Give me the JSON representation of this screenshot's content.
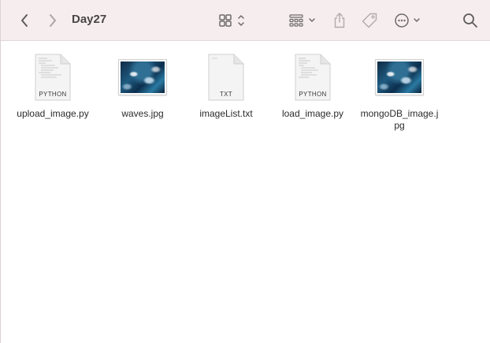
{
  "window": {
    "title": "Day27"
  },
  "toolbar": {
    "back_icon": "chevron-left-icon",
    "forward_icon": "chevron-right-icon",
    "view_icon": "grid-view-icon",
    "group_icon": "group-by-icon",
    "share_icon": "share-icon",
    "tag_icon": "tag-icon",
    "more_icon": "ellipsis-circle-icon",
    "search_icon": "search-icon"
  },
  "files": [
    {
      "name": "upload_image.py",
      "kind": "document",
      "badge": "PYTHON"
    },
    {
      "name": "waves.jpg",
      "kind": "image"
    },
    {
      "name": "imageList.txt",
      "kind": "document",
      "badge": "TXT"
    },
    {
      "name": "load_image.py",
      "kind": "document",
      "badge": "PYTHON"
    },
    {
      "name": "mongoDB_image.jpg",
      "kind": "image"
    }
  ],
  "colors": {
    "toolbar_bg": "#f6eeee",
    "icon_gray": "#6e6a6a"
  }
}
